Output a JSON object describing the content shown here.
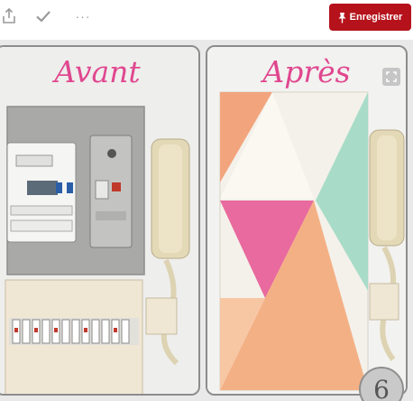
{
  "toolbar": {
    "share_icon": "share-icon",
    "check_icon": "check-icon",
    "more_label": "···",
    "save_label": "Enregistrer",
    "save_color": "#b5121b"
  },
  "pin": {
    "before_title": "Avant",
    "after_title": "Après",
    "page_number": "6",
    "title_color": "#e0478f"
  }
}
